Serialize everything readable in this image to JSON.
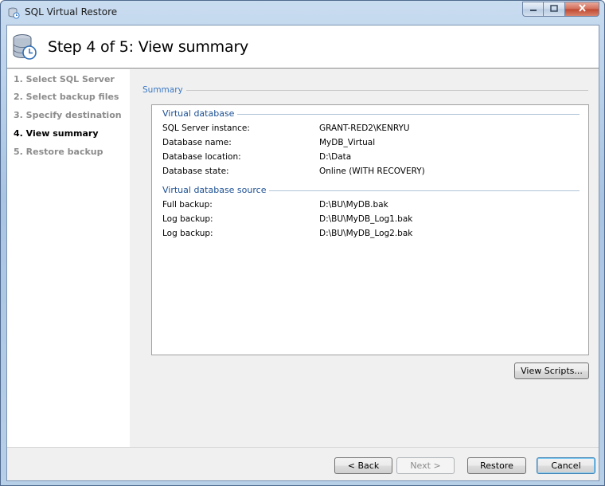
{
  "window": {
    "title": "SQL Virtual Restore",
    "app_icon": "database-restore-icon",
    "caption_buttons": [
      "minimize-icon",
      "maximize-icon",
      "close-icon"
    ]
  },
  "header": {
    "title": "Step 4 of 5: View summary",
    "icon": "database-clock-icon"
  },
  "sidebar": {
    "steps": [
      {
        "label": "1. Select SQL Server",
        "state": "done"
      },
      {
        "label": "2. Select backup files",
        "state": "done"
      },
      {
        "label": "3. Specify destination",
        "state": "done"
      },
      {
        "label": "4. View summary",
        "state": "current"
      },
      {
        "label": "5. Restore backup",
        "state": "pending"
      }
    ]
  },
  "summary": {
    "section_label": "Summary",
    "virtual_database": {
      "title": "Virtual database",
      "rows": [
        {
          "label": "SQL Server instance:",
          "value": "GRANT-RED2\\KENRYU"
        },
        {
          "label": "Database name:",
          "value": "MyDB_Virtual"
        },
        {
          "label": "Database location:",
          "value": "D:\\Data"
        },
        {
          "label": "Database state:",
          "value": "Online (WITH RECOVERY)"
        }
      ]
    },
    "virtual_database_source": {
      "title": "Virtual database source",
      "rows": [
        {
          "label": "Full backup:",
          "value": "D:\\BU\\MyDB.bak"
        },
        {
          "label": "Log backup:",
          "value": "D:\\BU\\MyDB_Log1.bak"
        },
        {
          "label": "Log backup:",
          "value": "D:\\BU\\MyDB_Log2.bak"
        }
      ]
    },
    "view_scripts_label": "View Scripts..."
  },
  "footer": {
    "back_label": "< Back",
    "next_label": "Next >",
    "restore_label": "Restore",
    "cancel_label": "Cancel"
  },
  "colors": {
    "accent": "#3a78c4",
    "group_title": "#1b4f93",
    "disabled_text": "#8c8c8c"
  }
}
